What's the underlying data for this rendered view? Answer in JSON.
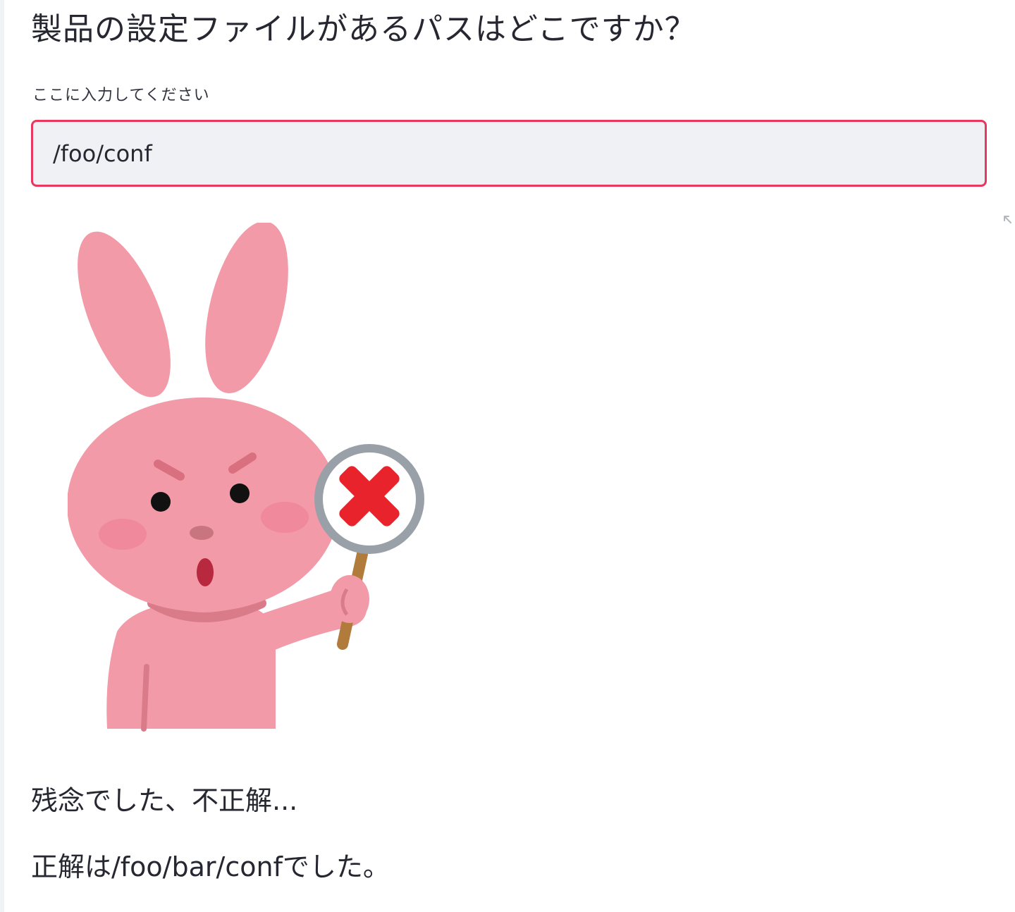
{
  "question": {
    "title": "製品の設定ファイルがあるパスはどこですか？"
  },
  "answer_input": {
    "label": "ここに入力してください",
    "value": "/foo/conf"
  },
  "result": {
    "image_icon": "rabbit-holding-x-sign",
    "message": "残念でした、不正解...",
    "correct_answer": "正解は/foo/bar/confでした。"
  },
  "colors": {
    "input_border_error": "#e8385f",
    "input_background": "#eff1f5",
    "rabbit_body": "#f29aa8",
    "cross_mark": "#e8232b"
  }
}
